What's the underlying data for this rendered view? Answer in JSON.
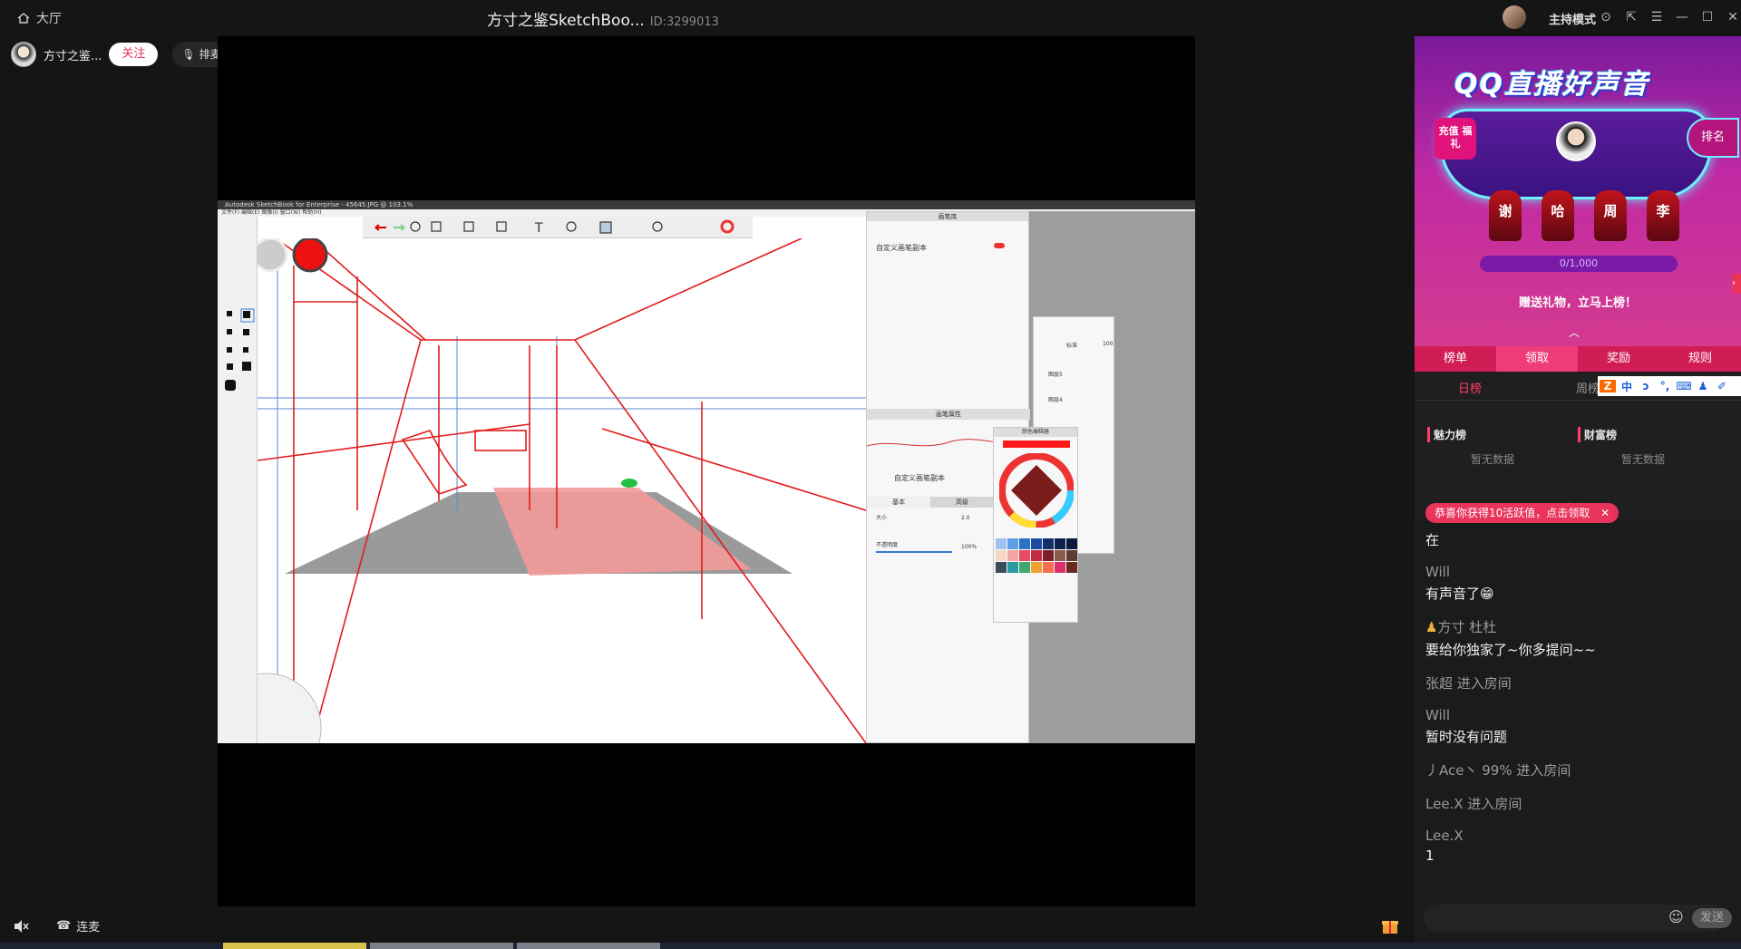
{
  "topbar": {
    "lobby_label": "大厅",
    "title": "方寸之鉴SketchBoo...",
    "room_id": "ID:3299013",
    "host_mode_label": "主持模式"
  },
  "streamer": {
    "name": "方寸之鉴...",
    "follow_label": "关注",
    "rank_label": "排麦"
  },
  "sketchbook": {
    "window_title": "Autodesk SketchBook for Enterprise - 45645.JPG @ 103.1%",
    "menu": "文件(F)  编辑(E)  图像(I)  窗口(W)  帮助(H)",
    "brush_library_title": "画笔库",
    "brush_name": "自定义画笔副本",
    "brush_props_title": "画笔属性",
    "brush_tab_basic": "基本",
    "brush_tab_advanced": "高级",
    "size_label": "大小",
    "size_value": "2.0",
    "opacity_label": "不透明度",
    "opacity_value": "100%",
    "color_editor_title": "颜色编辑器",
    "layer_mode": "标准",
    "layer_opacity": "100",
    "layer5": "图层5",
    "layer4": "图层4",
    "accent_red": "#ff1a1a",
    "swatches": [
      "#9fc3ee",
      "#5da0e6",
      "#2a72c9",
      "#1e4aa0",
      "#122f6e",
      "#0e1f4a",
      "#0b1a3c",
      "#f5d7c7",
      "#f3a6a6",
      "#e84a5f",
      "#c12a40",
      "#7a1f2b",
      "#8a5a4a",
      "#5c3b32",
      "#3a4b5a",
      "#2b9aa0",
      "#3ca86e",
      "#f0a030",
      "#f07050",
      "#d8306a",
      "#6a2a20"
    ]
  },
  "side": {
    "banner": {
      "logo": "QQ直播好声音",
      "recharge": "充值 福礼",
      "rank": "排名",
      "seats": [
        "谢",
        "哈",
        "周",
        "李"
      ],
      "progress": "0/1,000",
      "progress_value": 0,
      "progress_max": 1000,
      "hint": "赠送礼物，立马上榜！"
    },
    "tabs": [
      "榜单",
      "领取",
      "奖励",
      "规则"
    ],
    "day_tab": "日榜",
    "week_tab": "周榜",
    "ime": [
      "中",
      "ᴐ",
      "°,",
      "⌨",
      "♟",
      "✐"
    ],
    "charm_title": "魅力榜",
    "charm_empty": "暂无数据",
    "wealth_title": "财富榜",
    "wealth_empty": "暂无数据",
    "notice": "恭喜你获得10活跃值，点击领取",
    "chat": [
      {
        "text": "在"
      },
      {
        "user": "Will",
        "text": "有声音了😁"
      },
      {
        "user": "方寸 杜杜",
        "text": "要给你独家了~你多提问~~"
      },
      {
        "sys": "张超 进入房间"
      },
      {
        "user": "Will",
        "text": "暂时没有问题"
      },
      {
        "sys": "丿Ace丶 99% 进入房间"
      },
      {
        "sys": "Lee.X 进入房间"
      },
      {
        "user": "Lee.X",
        "text": "1"
      }
    ],
    "send_label": "发送"
  },
  "bottom": {
    "voice_label": "连麦"
  },
  "colors": {
    "accent": "#e8335a",
    "banner_top": "#7a1a9c",
    "banner_bottom": "#d43a8f"
  }
}
